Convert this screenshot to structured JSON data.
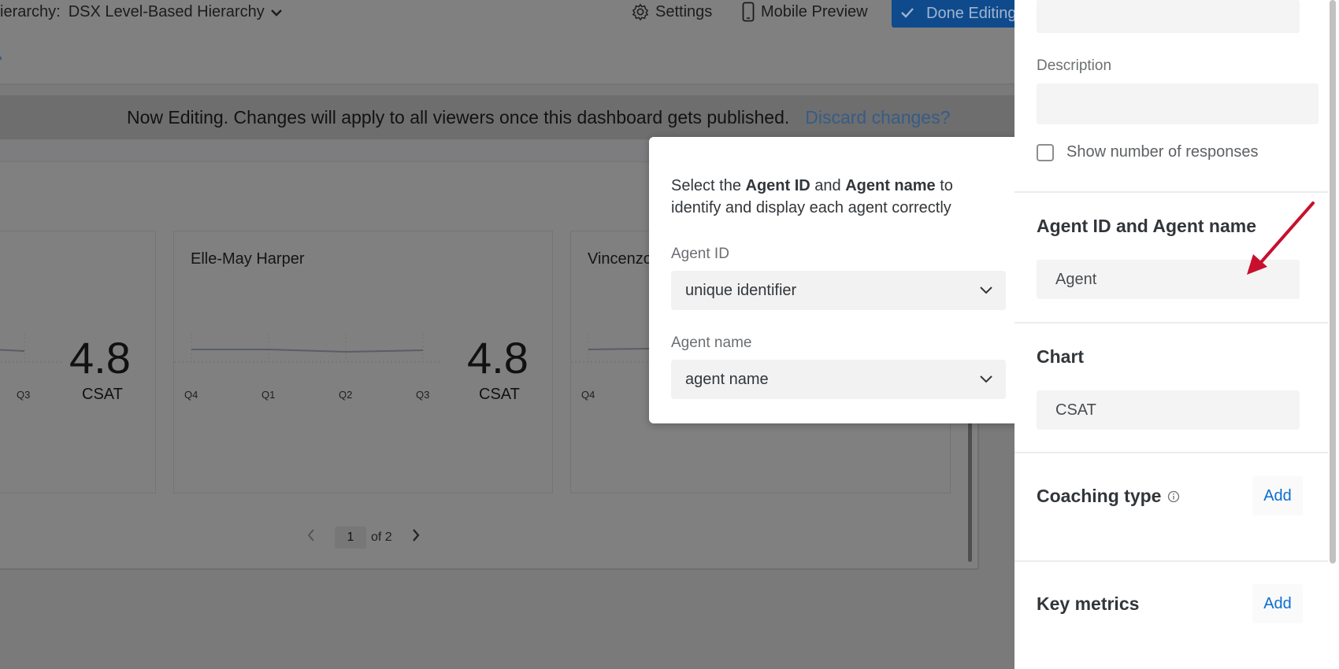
{
  "header": {
    "hierarchy_label": "ierarchy:",
    "hierarchy_value": "DSX Level-Based Hierarchy",
    "settings_label": "Settings",
    "mobile_preview_label": "Mobile Preview",
    "done_editing_label": "Done Editing"
  },
  "banner": {
    "message": "Now Editing. Changes will apply to all viewers once this dashboard gets published.",
    "discard_label": "Discard changes?"
  },
  "widget": {
    "cards": [
      {
        "name": "",
        "score": "4.8",
        "metric": "CSAT",
        "quarters": [
          "Q3"
        ],
        "trend": [
          3.0,
          2.9
        ]
      },
      {
        "name": "Elle-May Harper",
        "score": "4.8",
        "metric": "CSAT",
        "quarters": [
          "Q4",
          "Q1",
          "Q2",
          "Q3"
        ],
        "trend": [
          3.0,
          3.0,
          2.85,
          2.95
        ]
      },
      {
        "name": "Vincenzo",
        "quarters": [
          "Q4"
        ],
        "trend": [
          3.0,
          3.05
        ]
      }
    ],
    "pager": {
      "current": "1",
      "of_label": "of 2"
    }
  },
  "popover": {
    "intro_pre": "Select the ",
    "intro_b1": "Agent ID",
    "intro_mid": " and ",
    "intro_b2": "Agent name",
    "intro_post": " to identify and display each agent correctly",
    "agent_id_label": "Agent ID",
    "agent_id_value": "unique identifier",
    "agent_name_label": "Agent name",
    "agent_name_value": "agent name"
  },
  "panel": {
    "description_label": "Description",
    "show_responses_label": "Show number of responses",
    "agent_section_title": "Agent ID and Agent name",
    "agent_value": "Agent",
    "chart_title": "Chart",
    "chart_value": "CSAT",
    "coaching_title": "Coaching type",
    "coaching_add": "Add",
    "key_metrics_title": "Key metrics",
    "key_metrics_add": "Add"
  },
  "colors": {
    "accent_blue": "#0a6ed1",
    "annotation_red": "#c8102e",
    "overlay_gray": "#808080"
  }
}
